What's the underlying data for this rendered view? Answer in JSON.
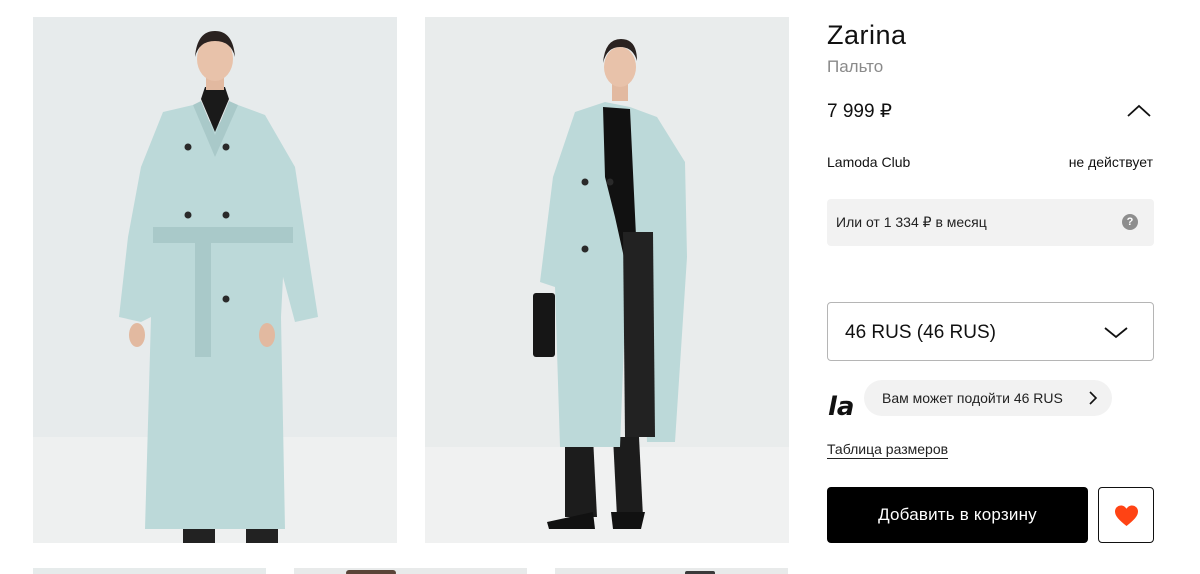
{
  "gallery": {
    "photos": [
      {
        "name": "coat-front-view-photo"
      },
      {
        "name": "coat-side-view-photo"
      }
    ],
    "thumbnails": [
      {
        "name": "thumbnail-1"
      },
      {
        "name": "thumbnail-2"
      },
      {
        "name": "thumbnail-3"
      }
    ]
  },
  "product": {
    "brand": "Zarina",
    "category": "Пальто",
    "price": "7 999 ₽",
    "collapse_icon": "chevron-up-icon"
  },
  "club": {
    "label": "Lamoda Club",
    "status": "не действует"
  },
  "installment": {
    "text": "Или от 1 334 ₽ в месяц",
    "help_icon": "?"
  },
  "size": {
    "selected": "46 RUS (46 RUS)",
    "chevron_icon": "chevron-down-icon"
  },
  "fit": {
    "logo_text": "la",
    "suggestion": "Вам может подойти 46 RUS",
    "chevron_icon": "chevron-right-icon"
  },
  "size_table_link": "Таблица размеров",
  "actions": {
    "add_to_cart": "Добавить в корзину",
    "favorite_icon": "heart-icon"
  },
  "colors": {
    "accent": "#ff4314",
    "button_bg": "#000000",
    "muted_text": "#8a8a8a",
    "panel_bg": "#f2f2f2",
    "coat": "#bcd9d9"
  }
}
